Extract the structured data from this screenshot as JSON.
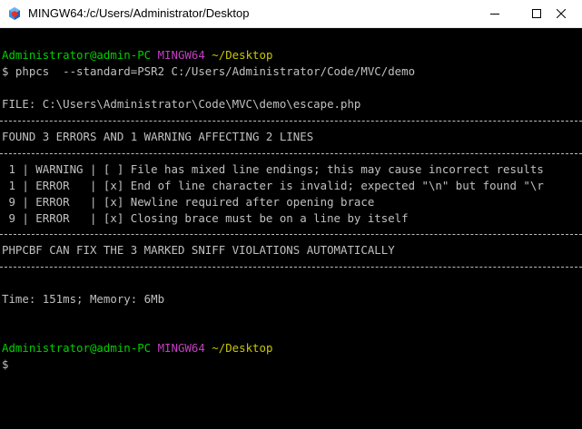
{
  "window": {
    "title": "MINGW64:/c/Users/Administrator/Desktop"
  },
  "prompt1": {
    "user_host": "Administrator@admin-PC",
    "env": "MINGW64",
    "cwd": "~/Desktop"
  },
  "command": "$ phpcs  --standard=PSR2 C:/Users/Administrator/Code/MVC/demo",
  "file_line": "FILE: C:\\Users\\Administrator\\Code\\MVC\\demo\\escape.php",
  "summary_line": "FOUND 3 ERRORS AND 1 WARNING AFFECTING 2 LINES",
  "violations": [
    {
      "text": " 1 | WARNING | [ ] File has mixed line endings; this may cause incorrect results"
    },
    {
      "text": " 1 | ERROR   | [x] End of line character is invalid; expected \"\\n\" but found \"\\r"
    },
    {
      "text": " 9 | ERROR   | [x] Newline required after opening brace"
    },
    {
      "text": " 9 | ERROR   | [x] Closing brace must be on a line by itself"
    }
  ],
  "fix_line": "PHPCBF CAN FIX THE 3 MARKED SNIFF VIOLATIONS AUTOMATICALLY",
  "timing_line": "Time: 151ms; Memory: 6Mb",
  "prompt2": {
    "user_host": "Administrator@admin-PC",
    "env": "MINGW64",
    "cwd": "~/Desktop"
  },
  "cursor_prompt": "$",
  "colors": {
    "user_host": "#00d000",
    "env": "#c040c0",
    "cwd": "#c8c800",
    "text": "#c0c0c0",
    "background": "#000000"
  },
  "icons": {
    "app": "mingw-terminal-icon",
    "minimize": "minimize-icon",
    "maximize": "maximize-icon",
    "close": "close-icon"
  }
}
